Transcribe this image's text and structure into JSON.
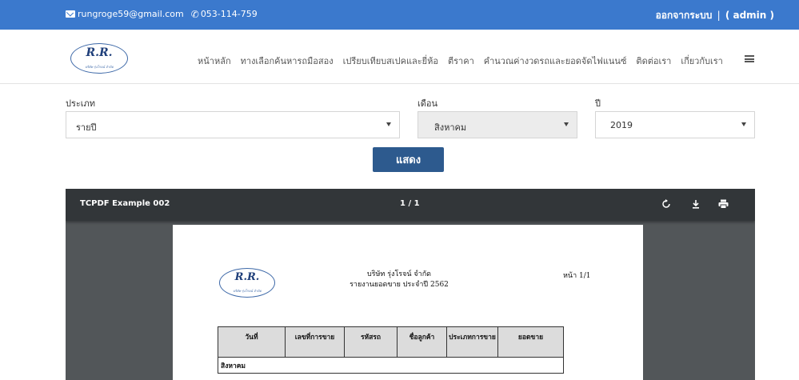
{
  "topbar": {
    "email": "rungroge59@gmail.com",
    "phone": "053-114-759",
    "logout_label": "ออกจากระบบ",
    "separator": "|",
    "user_label": "( admin )",
    "email_icon": "envelope-icon",
    "phone_icon": "phone-icon"
  },
  "navbar": {
    "logo_text": "R.R.",
    "logo_sub": "บริษัท รุ่งโรจน์ จำกัด",
    "items": [
      {
        "label": "หน้าหลัก"
      },
      {
        "label": "ทางเลือกค้นหารถมือสอง"
      },
      {
        "label": "เปรียบเทียบสเปคและยี่ห้อ"
      },
      {
        "label": "ตีราคา"
      },
      {
        "label": "คำนวณค่างวดรถและยอดจัดไฟแนนซ์"
      },
      {
        "label": "ติดต่อเรา"
      },
      {
        "label": "เกี่ยวกับเรา"
      }
    ],
    "menu_icon": "hamburger-menu-icon"
  },
  "filters": {
    "type_label": "ประเภท",
    "type_value": "รายปี",
    "month_label": "เดือน",
    "month_value": "สิงหาคม",
    "year_label": "ปี",
    "year_value": "2019",
    "show_label": "แสดง"
  },
  "viewer": {
    "title": "TCPDF Example 002",
    "page_indicator": "1 / 1",
    "rotate_icon": "rotate-icon",
    "download_icon": "download-icon",
    "print_icon": "print-icon"
  },
  "report": {
    "logo_text": "R.R.",
    "logo_sub": "บริษัท รุ่งโรจน์ จำกัด",
    "company": "บริษัท รุ่งโรจน์ จำกัด",
    "subtitle": "รายงานยอดขาย ประจำปี 2562",
    "page": "หน้า 1/1",
    "columns": [
      "วันที่",
      "เลขที่การขาย",
      "รหัสรถ",
      "ชื่อลูกค้า",
      "ประเภทการขาย",
      "ยอดขาย"
    ],
    "group_row": "สิงหาคม"
  },
  "colors": {
    "topbar": "#3b79cd",
    "button": "#2d5a8e",
    "viewer_toolbar": "#323639",
    "viewer_bg": "#525659"
  }
}
